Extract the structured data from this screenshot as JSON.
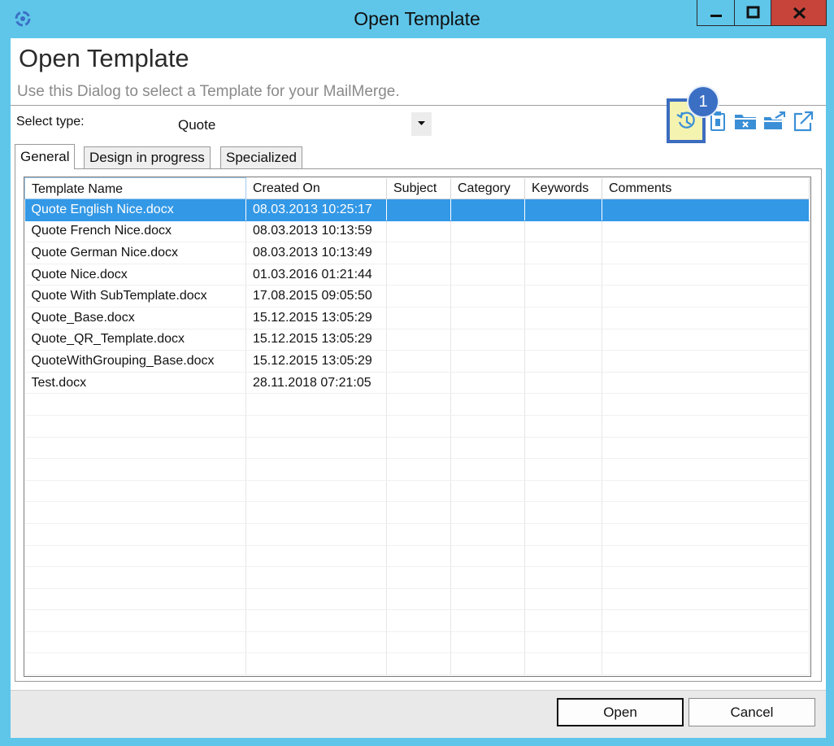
{
  "window": {
    "title": "Open Template",
    "controls": [
      "minimize-icon",
      "maximize-icon",
      "close-icon"
    ]
  },
  "header": {
    "title": "Open Template",
    "subtitle": "Use this Dialog to select a Template for your MailMerge."
  },
  "type_selector": {
    "label": "Select type:",
    "value": "Quote"
  },
  "toolbar": {
    "icons": [
      "history-icon",
      "delete-template-icon",
      "remove-folder-icon",
      "move-to-folder-icon",
      "open-external-icon"
    ],
    "highlighted_index": 0,
    "callout_number": "1",
    "highlight_color": "#f4f3b0",
    "callout_color": "#3b6fc4"
  },
  "tabs": [
    {
      "label": "General",
      "active": true
    },
    {
      "label": "Design in progress",
      "active": false
    },
    {
      "label": "Specialized",
      "active": false
    }
  ],
  "table": {
    "columns": [
      "Template Name",
      "Created On",
      "Subject",
      "Category",
      "Keywords",
      "Comments"
    ],
    "rows": [
      {
        "name": "Quote English Nice.docx",
        "created": "08.03.2013 10:25:17",
        "selected": true
      },
      {
        "name": "Quote French Nice.docx",
        "created": "08.03.2013 10:13:59"
      },
      {
        "name": "Quote German Nice.docx",
        "created": "08.03.2013 10:13:49"
      },
      {
        "name": "Quote Nice.docx",
        "created": "01.03.2016 01:21:44"
      },
      {
        "name": "Quote With SubTemplate.docx",
        "created": "17.08.2015 09:05:50"
      },
      {
        "name": "Quote_Base.docx",
        "created": "15.12.2015 13:05:29"
      },
      {
        "name": "Quote_QR_Template.docx",
        "created": "15.12.2015 13:05:29"
      },
      {
        "name": "QuoteWithGrouping_Base.docx",
        "created": "15.12.2015 13:05:29"
      },
      {
        "name": "Test.docx",
        "created": "28.11.2018 07:21:05"
      }
    ],
    "selection_color": "#3398e6"
  },
  "footer": {
    "open_label": "Open",
    "cancel_label": "Cancel"
  },
  "colors": {
    "titlebar": "#5fc6ea",
    "close_button": "#c7443b"
  }
}
